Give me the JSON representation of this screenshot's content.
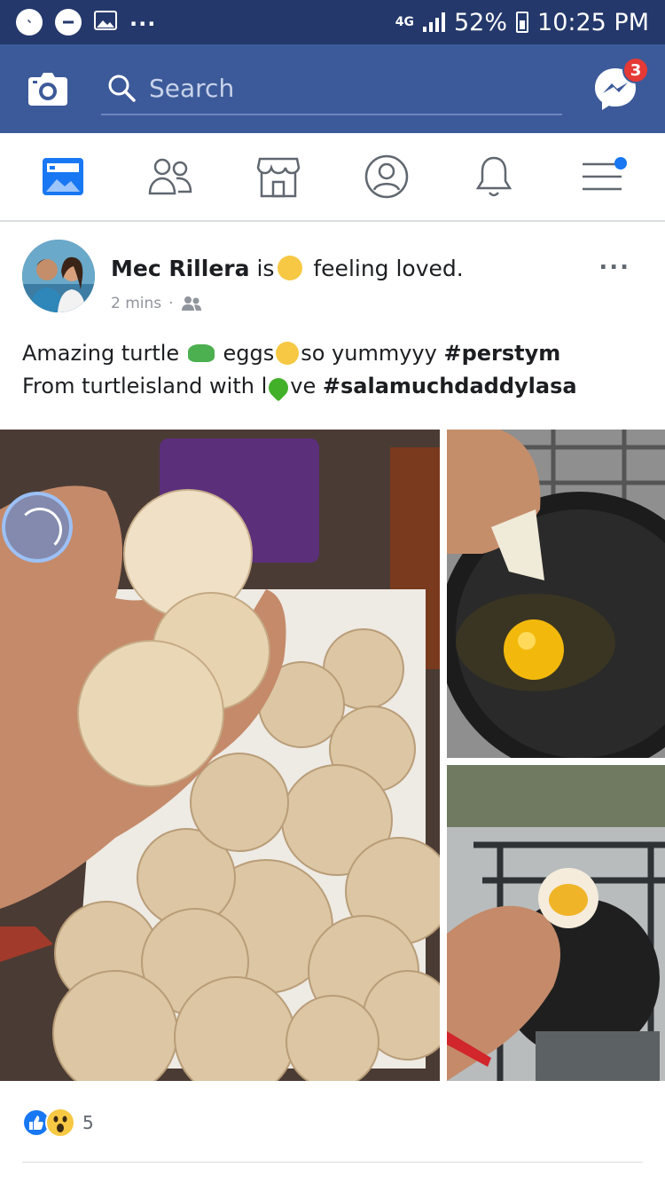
{
  "status_bar": {
    "network": "4G",
    "battery": "52%",
    "time": "10:25 PM",
    "overflow": "..."
  },
  "header": {
    "search_placeholder": "Search",
    "messenger_badge": "3"
  },
  "nav": {
    "items": [
      "news-feed",
      "friends",
      "marketplace",
      "profile",
      "notifications",
      "menu"
    ]
  },
  "post": {
    "author": "Mec Rillera",
    "verb": "is",
    "feeling": "feeling loved.",
    "time": "2 mins",
    "more": "...",
    "caption": {
      "line1_a": "Amazing turtle",
      "line1_b": "eggs",
      "line1_c": "so yummyyy",
      "line1_tag": "#perstym",
      "line2_a": "From turtleisland with l",
      "line2_b": "ve",
      "line2_tag": "#salamuchdaddylasa"
    },
    "reactions_count": "5"
  },
  "colors": {
    "status_bar": "#24386b",
    "header": "#3c5a99",
    "like_blue": "#1877f2",
    "badge_red": "#e53935"
  }
}
